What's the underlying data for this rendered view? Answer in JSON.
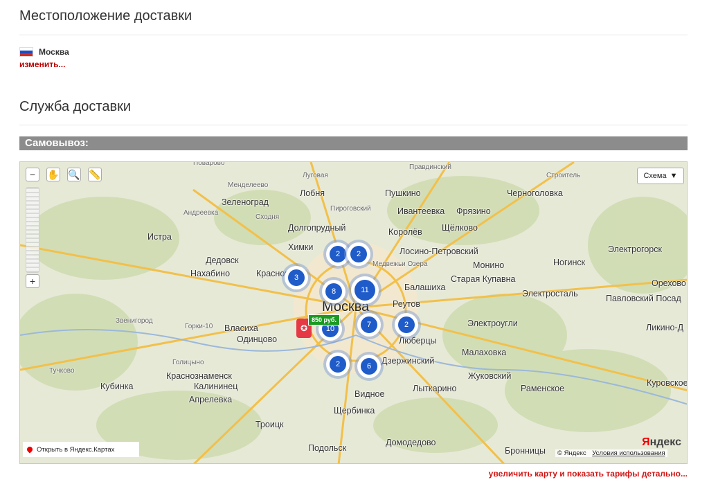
{
  "location": {
    "title": "Местоположение доставки",
    "city": "Москва",
    "change_link": "изменить..."
  },
  "delivery": {
    "title": "Служба доставки",
    "pickup_label": "Самовывоз:"
  },
  "map": {
    "scheme_button": "Схема",
    "open_in_yandex": "Открыть в Яндекс.Картах",
    "copyright": "© Яндекс",
    "terms": "Условия использования",
    "logo_y": "Я",
    "logo_rest": "ндекс",
    "price_tag": "850 руб.",
    "clusters": [
      "2",
      "2",
      "3",
      "8",
      "11",
      "7",
      "2",
      "10",
      "2",
      "6"
    ],
    "places": [
      "Поварово",
      "Луговая",
      "Правдинский",
      "Менделеево",
      "Лобня",
      "Пушкино",
      "Строитель",
      "Черноголовка",
      "Зеленоград",
      "Пироговский",
      "Ивантеевка",
      "Фрязино",
      "Андреевка",
      "Сходня",
      "Долгопрудный",
      "Королёв",
      "Щёлково",
      "Истра",
      "Химки",
      "Лосино-Петровский",
      "Электрогорск",
      "Дедовск",
      "Медвежьи Озера",
      "Монино",
      "Ногинск",
      "Нахабино",
      "Красногорск",
      "Старая Купавна",
      "Балашиха",
      "Реутов",
      "Электросталь",
      "Павловский Посад",
      "Москва",
      "Звенигород",
      "Горки-10",
      "Власиха",
      "Электроугли",
      "Одинцово",
      "Люберцы",
      "Малаховка",
      "Голицыно",
      "Дзержинский",
      "Краснознаменск",
      "Калининец",
      "Жуковский",
      "Куровское",
      "Кубинка",
      "Апрелевка",
      "Видное",
      "Лыткарино",
      "Раменское",
      "Троицк",
      "Щербинка",
      "Домодедово",
      "Подольск",
      "Бронницы",
      "Тучково",
      "Орехово",
      "Ликино-Д"
    ]
  },
  "enlarge_link": "увеличить карту и показать тарифы детально..."
}
